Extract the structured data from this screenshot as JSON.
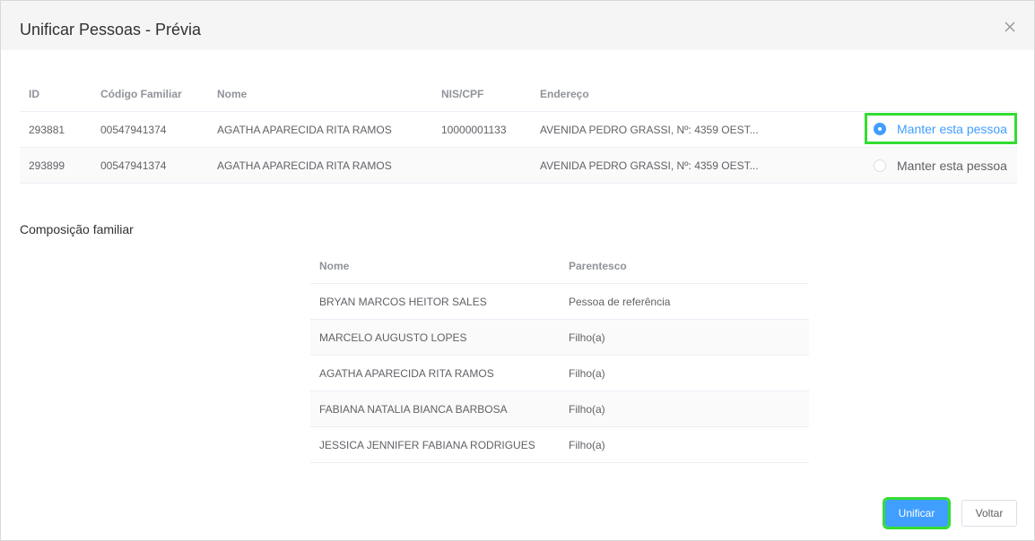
{
  "dialog": {
    "title": "Unificar Pessoas - Prévia",
    "close_icon": "close-icon"
  },
  "persons_table": {
    "headers": {
      "id": "ID",
      "codigo": "Código Familiar",
      "nome": "Nome",
      "nis": "NIS/CPF",
      "endereco": "Endereço"
    },
    "rows": [
      {
        "id": "293881",
        "codigo": "00547941374",
        "nome": "AGATHA APARECIDA RITA RAMOS",
        "nis": "10000001133",
        "endereco": "AVENIDA PEDRO GRASSI, Nº: 4359 OEST...",
        "radio_label": "Manter esta pessoa",
        "selected": true
      },
      {
        "id": "293899",
        "codigo": "00547941374",
        "nome": "AGATHA APARECIDA RITA RAMOS",
        "nis": "",
        "endereco": "AVENIDA PEDRO GRASSI, Nº: 4359 OEST...",
        "radio_label": "Manter esta pessoa",
        "selected": false
      }
    ]
  },
  "family_section": {
    "title": "Composição familiar",
    "headers": {
      "nome": "Nome",
      "parentesco": "Parentesco"
    },
    "rows": [
      {
        "nome": "BRYAN MARCOS HEITOR SALES",
        "parentesco": "Pessoa de referência"
      },
      {
        "nome": "MARCELO AUGUSTO LOPES",
        "parentesco": "Filho(a)"
      },
      {
        "nome": "AGATHA APARECIDA RITA RAMOS",
        "parentesco": "Filho(a)"
      },
      {
        "nome": "FABIANA NATALIA BIANCA BARBOSA",
        "parentesco": "Filho(a)"
      },
      {
        "nome": "JESSICA JENNIFER FABIANA RODRIGUES",
        "parentesco": "Filho(a)"
      }
    ]
  },
  "footer": {
    "unificar_label": "Unificar",
    "voltar_label": "Voltar"
  },
  "colors": {
    "primary": "#409eff",
    "highlight": "#33dd33"
  }
}
